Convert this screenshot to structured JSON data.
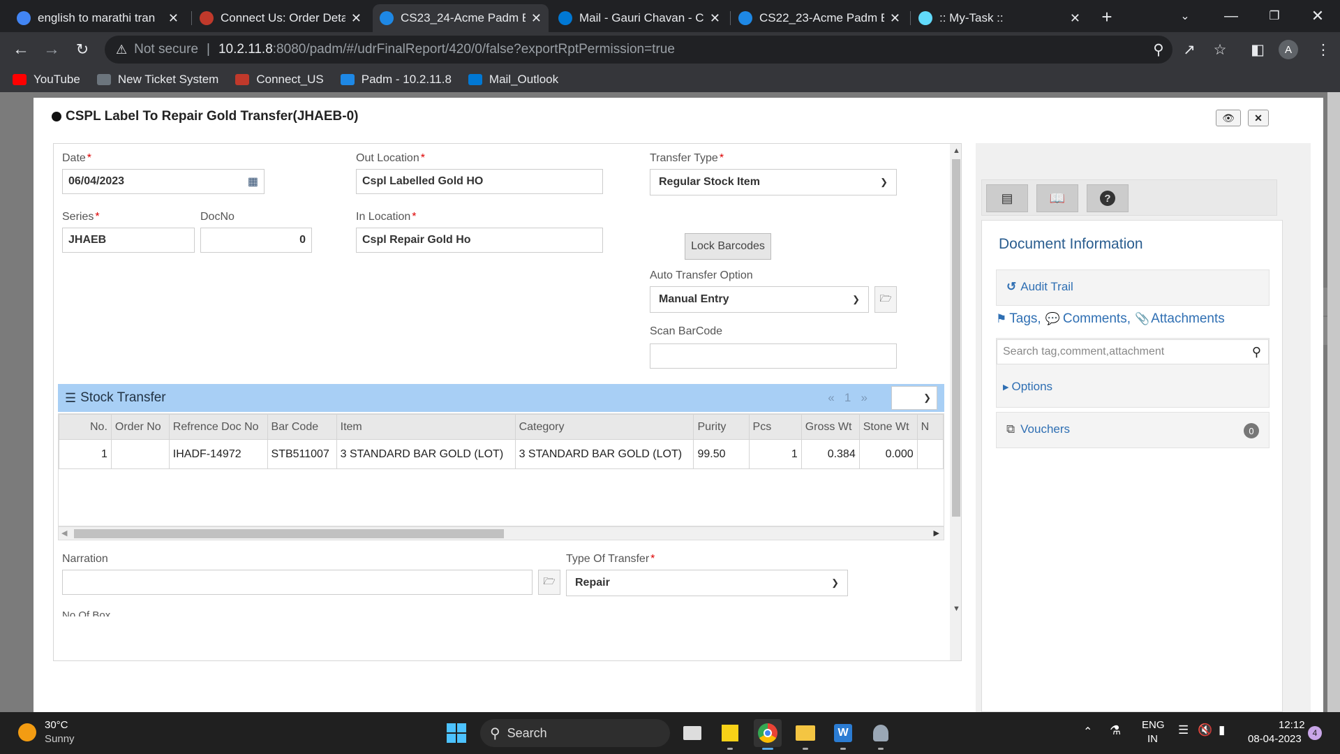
{
  "browser": {
    "tabs": [
      {
        "title": "english to marathi tran",
        "icon": "google-icon",
        "color": "#4285f4"
      },
      {
        "title": "Connect Us: Order Deta",
        "icon": "connect-icon",
        "color": "#c0392b"
      },
      {
        "title": "CS23_24-Acme Padm E",
        "icon": "padm-icon",
        "color": "#1e88e5",
        "active": true
      },
      {
        "title": "Mail - Gauri Chavan - C",
        "icon": "outlook-icon",
        "color": "#0078d4"
      },
      {
        "title": "CS22_23-Acme Padm E",
        "icon": "padm-icon",
        "color": "#1e88e5"
      },
      {
        "title": ":: My-Task ::",
        "icon": "react-icon",
        "color": "#61dafb"
      }
    ],
    "new_tab": "+",
    "security": "Not secure",
    "url_host": "10.2.11.8",
    "url_rest": ":8080/padm/#/udrFinalReport/420/0/false?exportRptPermission=true",
    "avatar": "A",
    "bookmarks": [
      {
        "label": "YouTube",
        "color": "#ff0000"
      },
      {
        "label": "New Ticket System",
        "color": "#6c757d"
      },
      {
        "label": "Connect_US",
        "color": "#c0392b"
      },
      {
        "label": "Padm - 10.2.11.8",
        "color": "#1e88e5"
      },
      {
        "label": "Mail_Outlook",
        "color": "#0078d4"
      }
    ]
  },
  "modal": {
    "title": "CSPL Label To Repair Gold Transfer(JHAEB-0)",
    "form": {
      "date_label": "Date",
      "date_value": "06/04/2023",
      "out_location_label": "Out Location",
      "out_location_value": "Cspl Labelled Gold HO",
      "transfer_type_label": "Transfer Type",
      "transfer_type_value": "Regular Stock Item",
      "series_label": "Series",
      "series_value": "JHAEB",
      "docno_label": "DocNo",
      "docno_value": "0",
      "in_location_label": "In Location",
      "in_location_value": "Cspl Repair Gold Ho",
      "lock_barcodes": "Lock Barcodes",
      "auto_transfer_label": "Auto Transfer Option",
      "auto_transfer_value": "Manual Entry",
      "scan_barcode_label": "Scan BarCode",
      "scan_barcode_value": "",
      "narration_label": "Narration",
      "narration_value": "",
      "type_of_transfer_label": "Type Of Transfer",
      "type_of_transfer_value": "Repair",
      "no_of_box_label": "No Of Box",
      "required_mark": "*"
    },
    "stock_transfer": {
      "title": "Stock Transfer",
      "pager_prev": "«",
      "pager_page": "1",
      "pager_next": "»",
      "columns": [
        "No.",
        "Order No",
        "Refrence Doc No",
        "Bar Code",
        "Item",
        "Category",
        "Purity",
        "Pcs",
        "Gross Wt",
        "Stone Wt",
        "N"
      ],
      "rows": [
        [
          "1",
          "",
          "IHADF-14972",
          "STB511007",
          "3 STANDARD BAR GOLD (LOT)",
          "3 STANDARD BAR GOLD (LOT)",
          "99.50",
          "1",
          "0.384",
          "0.000",
          ""
        ]
      ]
    }
  },
  "right_panel": {
    "doc_info": "Document Information",
    "audit_trail": "Audit Trail",
    "tags": "Tags,",
    "comments": "Comments,",
    "attachments": "Attachments",
    "search_placeholder": "Search tag,comment,attachment",
    "options": "Options",
    "vouchers": "Vouchers",
    "vouchers_count": "0"
  },
  "taskbar": {
    "weather_temp": "30°C",
    "weather_desc": "Sunny",
    "search": "Search",
    "lang1": "ENG",
    "lang2": "IN",
    "time": "12:12",
    "date": "08-04-2023",
    "notif_count": "4"
  }
}
